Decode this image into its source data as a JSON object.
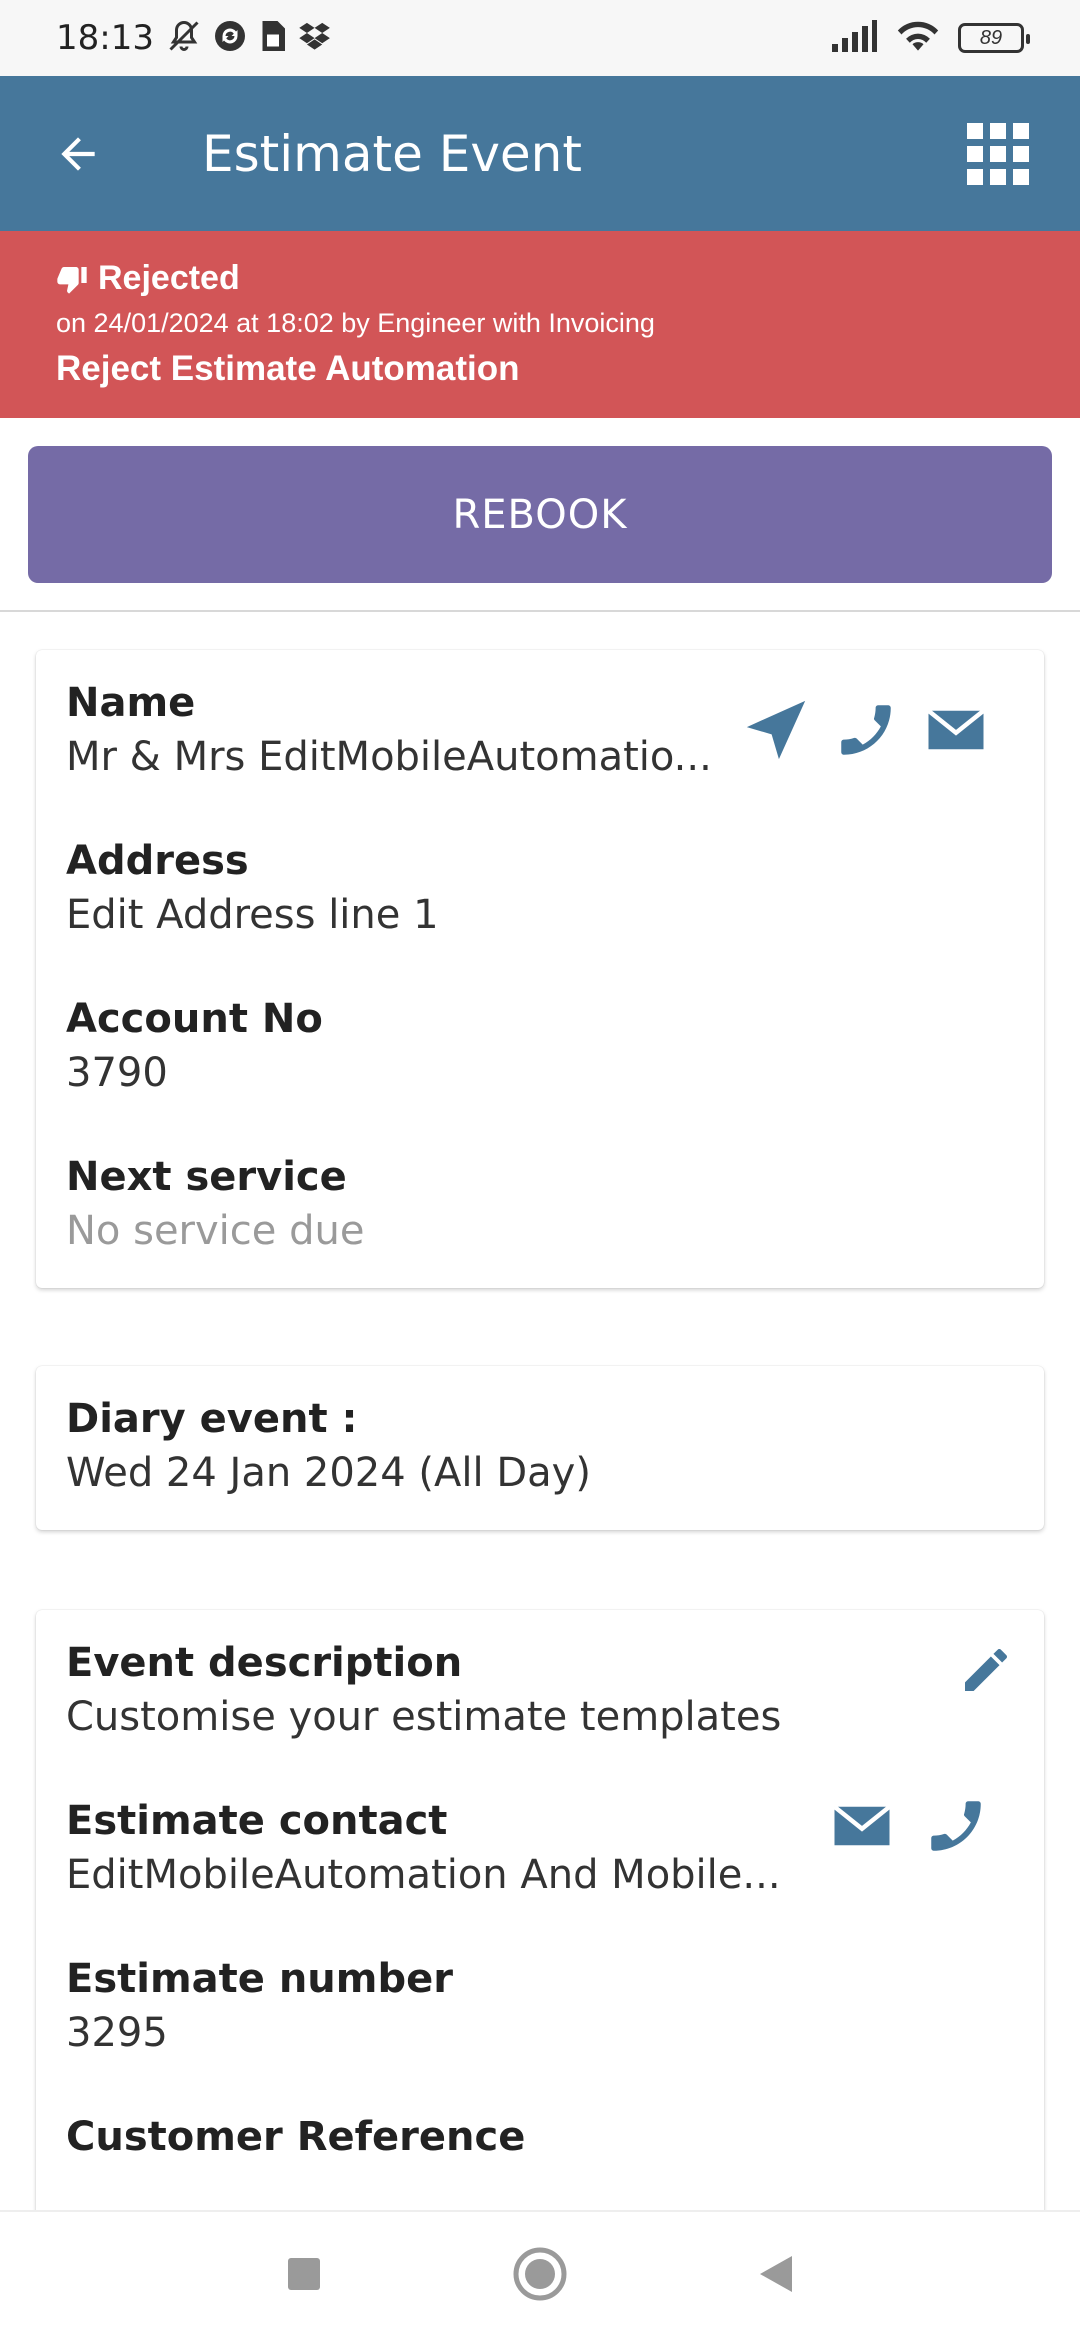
{
  "status_bar": {
    "time": "18:13",
    "battery": "89",
    "icons_left": [
      "mute-icon",
      "sync-icon",
      "sim-icon",
      "dropbox-icon"
    ],
    "icons_right": [
      "signal-icon",
      "wifi-icon",
      "battery-icon"
    ]
  },
  "app_bar": {
    "title": "Estimate Event",
    "background": "#46779b"
  },
  "banner": {
    "status": "Rejected",
    "meta": "on 24/01/2024 at 18:02 by Engineer with Invoicing",
    "automation": "Reject Estimate Automation",
    "background": "#d25557"
  },
  "rebook": {
    "label": "REBOOK",
    "background": "#756ba6"
  },
  "customer_card": {
    "name_label": "Name",
    "name_value": "Mr & Mrs EditMobileAutomatio...",
    "address_label": "Address",
    "address_value": "Edit Address line 1",
    "account_label": "Account No",
    "account_value": "3790",
    "next_service_label": "Next service",
    "next_service_value": "No service due"
  },
  "diary_card": {
    "label": "Diary event :",
    "value": "Wed 24 Jan 2024 (All Day)"
  },
  "estimate_card": {
    "description_label": "Event description",
    "description_value": "Customise your estimate templates",
    "contact_label": "Estimate contact",
    "contact_value": "EditMobileAutomation And Mobile...",
    "number_label": "Estimate number",
    "number_value": "3295",
    "reference_label": "Customer Reference"
  },
  "accent_color": "#46779b"
}
